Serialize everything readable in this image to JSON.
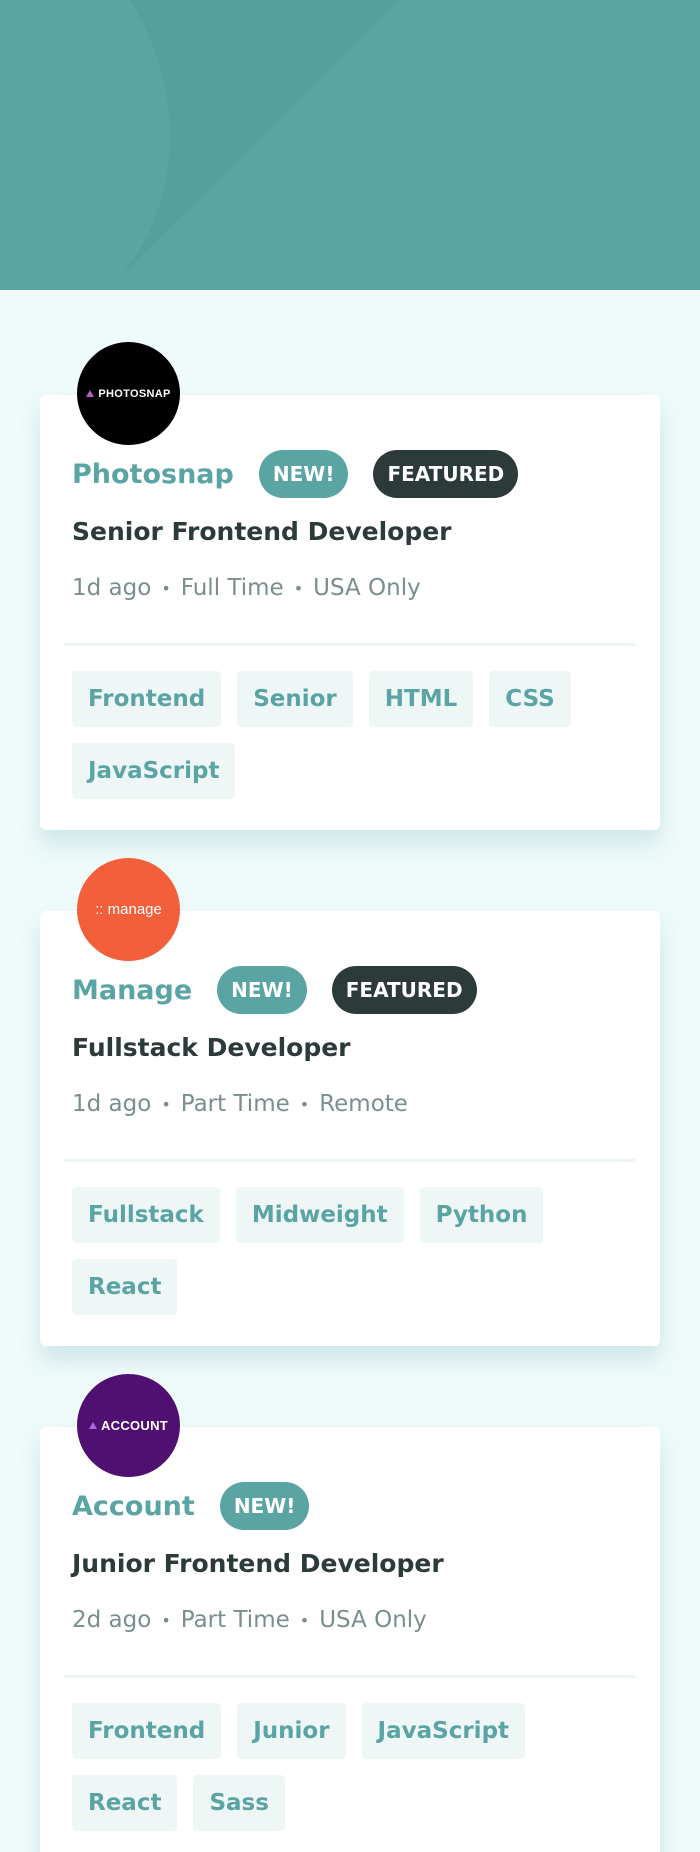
{
  "header": {
    "background": "#5ba4a4"
  },
  "jobs": [
    {
      "logo_text": "PHOTOSNAP",
      "logo_color": "#000000",
      "company": "Photosnap",
      "new_label": "NEW!",
      "featured_label": "FEATURED",
      "position": "Senior Frontend Developer",
      "posted": "1d ago",
      "contract": "Full Time",
      "location": "USA Only",
      "tags": [
        "Frontend",
        "Senior",
        "HTML",
        "CSS",
        "JavaScript"
      ]
    },
    {
      "logo_text": ":: manage",
      "logo_color": "#f25f3a",
      "company": "Manage",
      "new_label": "NEW!",
      "featured_label": "FEATURED",
      "position": "Fullstack Developer",
      "posted": "1d ago",
      "contract": "Part Time",
      "location": "Remote",
      "tags": [
        "Fullstack",
        "Midweight",
        "Python",
        "React"
      ]
    },
    {
      "logo_text": "ACCOUNT",
      "logo_color": "#4f1072",
      "company": "Account",
      "new_label": "NEW!",
      "position": "Junior Frontend Developer",
      "posted": "2d ago",
      "contract": "Part Time",
      "location": "USA Only",
      "tags": [
        "Frontend",
        "Junior",
        "JavaScript",
        "React",
        "Sass"
      ]
    }
  ]
}
